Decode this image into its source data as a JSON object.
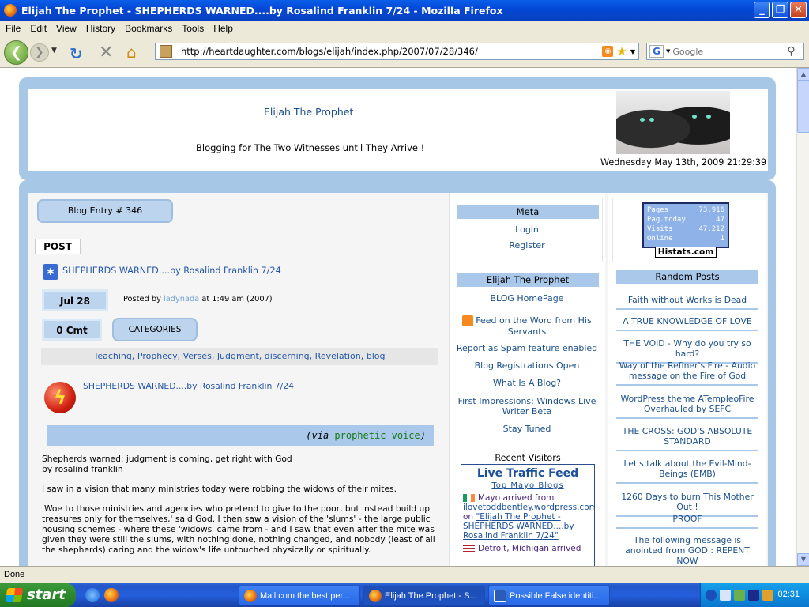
{
  "window": {
    "title": "Elijah The Prophet - SHEPHERDS WARNED....by Rosalind Franklin 7/24 - Mozilla Firefox",
    "min_label": "_",
    "max_label": "❐",
    "close_label": "✕"
  },
  "menu": [
    "File",
    "Edit",
    "View",
    "History",
    "Bookmarks",
    "Tools",
    "Help"
  ],
  "toolbar": {
    "url": "http://heartdaughter.com/blogs/elijah/index.php/2007/07/28/346/",
    "search_placeholder": "Google",
    "search_engine_letter": "G"
  },
  "header": {
    "blog_title": "Elijah The Prophet",
    "tagline": "Blogging for The Two Witnesses until They Arrive !",
    "datetime": "Wednesday May 13th, 2009 21:29:39"
  },
  "post": {
    "entry_label": "Blog Entry # 346",
    "tab_label": "POST",
    "title": "SHEPHERDS WARNED....by Rosalind Franklin 7/24",
    "date": "Jul 28",
    "posted_prefix": "Posted by",
    "author": "ladynada",
    "posted_suffix": "at 1:49 am (2007)",
    "comments": "0 Cmt",
    "categories_label": "CATEGORIES",
    "tags": [
      "Teaching",
      "Prophecy",
      "Verses",
      "Judgment",
      "discerning",
      "Revelation",
      "blog"
    ],
    "feed_title": "SHEPHERDS WARNED....by Rosalind Franklin 7/24",
    "via_prefix": "(via ",
    "via_link": "prophetic voice",
    "via_suffix": ")",
    "paragraphs": [
      "Shepherds warned: judgment is coming, get right with God\nby rosalind franklin",
      "I saw in a vision that many ministries today were robbing the widows of their mites.",
      "'Woe to those ministries and agencies who pretend to give to the poor, but instead build up treasures only for themselves,' said God. I then saw a vision of the 'slums' - the large public housing schemes - where these 'widows' came from - and I saw that even after the mite was given they were still the slums, with nothing done, nothing changed, and nobody (least of all the shepherds) caring and the widow's life untouched physically or spiritually."
    ]
  },
  "sidebar_mid": {
    "meta_title": "Meta",
    "meta_links": [
      "Login",
      "Register"
    ],
    "blog_title": "Elijah The Prophet",
    "links": [
      "BLOG HomePage",
      "Feed on the Word from His Servants",
      "Report as Spam feature enabled",
      "Blog Registrations Open",
      "What Is A Blog?",
      "First Impressions: Windows Live Writer Beta",
      "Stay Tuned"
    ],
    "recent_visitors_title": "Recent Visitors",
    "live_feed": {
      "title": "Live Traffic Feed",
      "subtitle": "Top Mayo Blogs",
      "entry1_visitor": "Mayo arrived from",
      "entry1_source": "ilovetoddbentley.wordpress.com",
      "entry1_on": "on",
      "entry1_page": "\"Elijah The Prophet - SHEPHERDS WARNED....by Rosalind Franklin 7/24\"",
      "entry2_visitor": "Detroit, Michigan arrived"
    }
  },
  "sidebar_right": {
    "histats": {
      "rows": [
        {
          "label": "Pages",
          "value": "73.916"
        },
        {
          "label": "Pag.today",
          "value": "47"
        },
        {
          "label": "Visits",
          "value": "47.212"
        },
        {
          "label": "Online",
          "value": "1"
        }
      ],
      "brand": "Histats.com"
    },
    "random_posts_title": "Random Posts",
    "random_posts": [
      "Faith without Works is Dead",
      "A TRUE KNOWLEDGE OF LOVE",
      "THE VOID - Why do you try so hard?",
      "Way of the Refiner's Fire - Audio message on the Fire of God",
      "WordPress theme ATempleoFire Overhauled by SEFC",
      "THE CROSS: GOD'S ABSOLUTE STANDARD",
      "Let's talk about the Evil-Mind-Beings (EMB)",
      "1260 Days to burn This Mother Out !",
      "PROOF",
      "The following message is anointed from GOD : REPENT NOW"
    ]
  },
  "status": "Done",
  "taskbar": {
    "start": "start",
    "tasks": [
      "Mail.com the best per...",
      "Elijah The Prophet - S...",
      "Possible False identiti..."
    ],
    "time": "02:31"
  }
}
